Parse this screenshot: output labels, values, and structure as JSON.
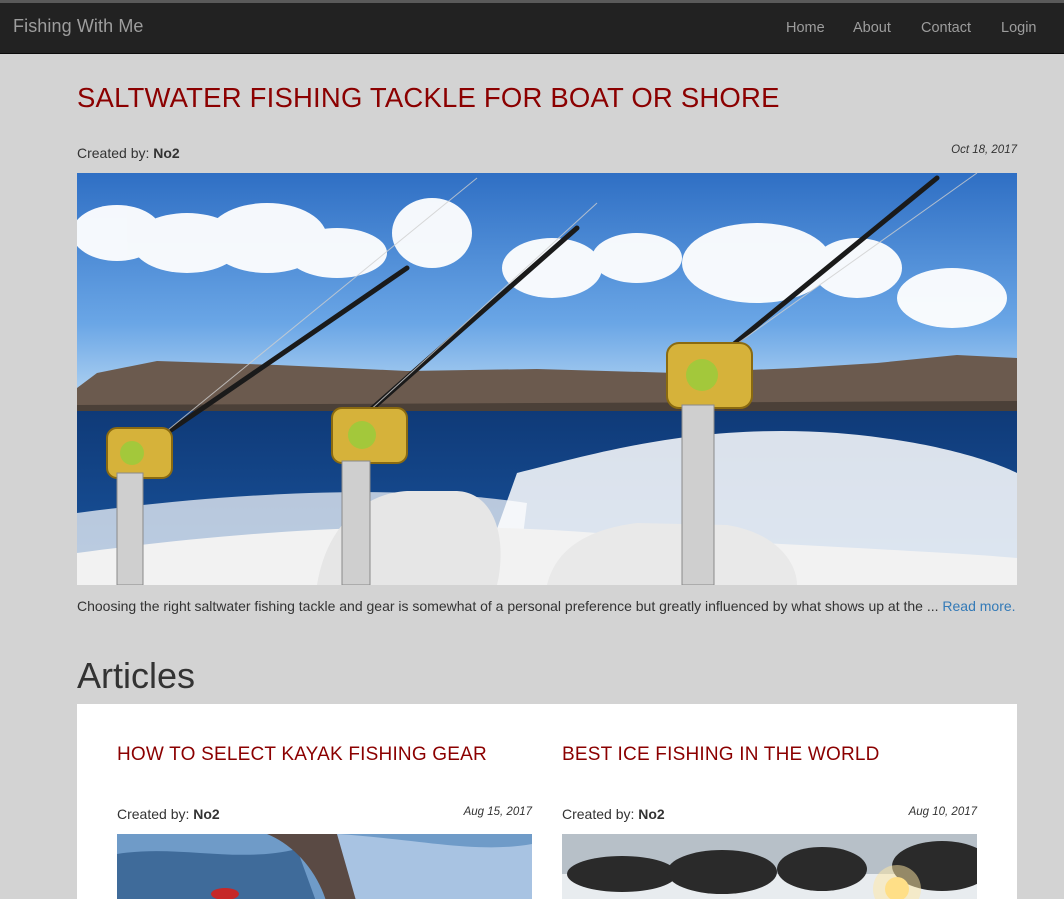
{
  "navbar": {
    "brand": "Fishing With Me",
    "links": [
      "Home",
      "About",
      "Contact",
      "Login"
    ]
  },
  "featured": {
    "title": "SALTWATER FISHING TACKLE FOR BOAT OR SHORE",
    "created_by_label": "Created by:",
    "author": "No2",
    "date": "Oct 18, 2017",
    "excerpt": "Choosing the right saltwater fishing tackle and gear is somewhat of a personal preference but greatly influenced by what shows up at the ...",
    "read_more": "Read more."
  },
  "articles_section": {
    "heading": "Articles",
    "items": [
      {
        "title": "HOW TO SELECT KAYAK FISHING GEAR",
        "created_by_label": "Created by:",
        "author": "No2",
        "date": "Aug 15, 2017"
      },
      {
        "title": "BEST ICE FISHING IN THE WORLD",
        "created_by_label": "Created by:",
        "author": "No2",
        "date": "Aug 10, 2017"
      }
    ]
  }
}
